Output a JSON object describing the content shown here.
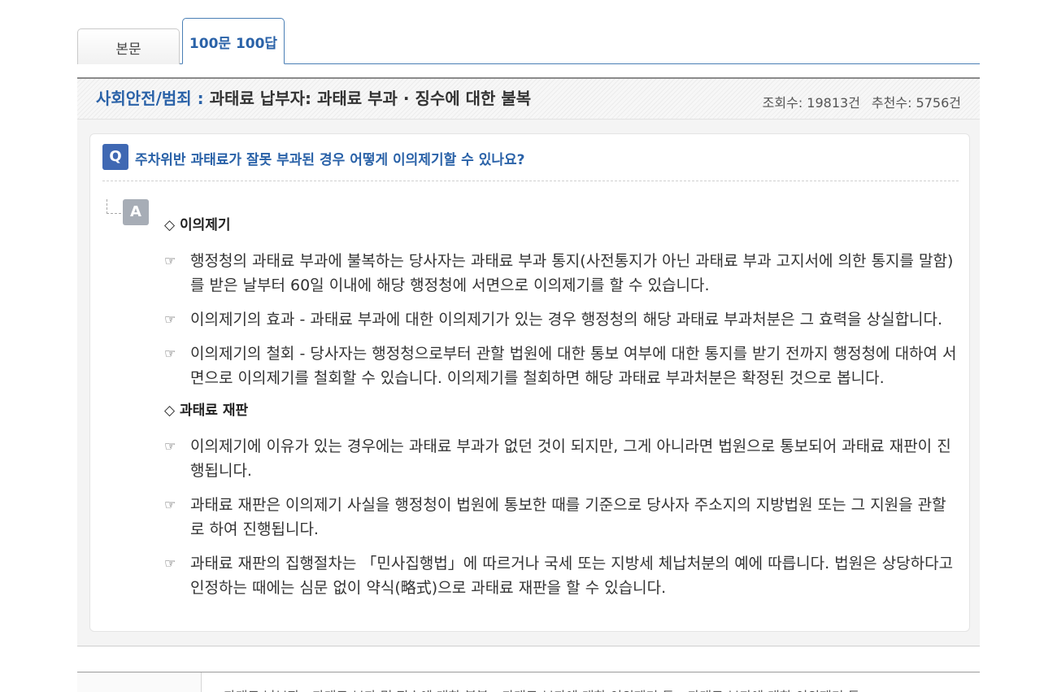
{
  "tabs": [
    {
      "label": "본문",
      "active": false
    },
    {
      "label": "100문 100답",
      "active": true
    }
  ],
  "title_bar": {
    "category": "사회안전/범죄",
    "separator": " : ",
    "title": "과태료 납부자: 과태료 부과 · 징수에 대한 불복",
    "views": "조회수: 19813건",
    "recommends": "추천수: 5756건"
  },
  "question": {
    "badge": "Q",
    "text": "주차위반 과태료가 잘못 부과된 경우 어떻게 이의제기할 수 있나요?"
  },
  "answer": {
    "badge": "A",
    "sections": [
      {
        "heading": "◇ 이의제기",
        "items": [
          "행정청의 과태료 부과에 불복하는 당사자는 과태료 부과 통지(사전통지가 아닌 과태료 부과 고지서에 의한 통지를 말함)를 받은 날부터 60일 이내에 해당 행정청에 서면으로 이의제기를 할 수 있습니다.",
          "이의제기의 효과 - 과태료 부과에 대한 이의제기가 있는 경우 행정청의 해당 과태료 부과처분은 그 효력을 상실합니다.",
          "이의제기의 철회 - 당사자는 행정청으로부터 관할 법원에 대한 통보 여부에 대한 통지를 받기 전까지 행정청에 대하여 서면으로 이의제기를 철회할 수 있습니다. 이의제기를 철회하면 해당 과태료 부과처분은 확정된 것으로 봅니다."
        ]
      },
      {
        "heading": "◇ 과태료 재판",
        "items": [
          "이의제기에 이유가 있는 경우에는 과태료 부과가 없던 것이 되지만, 그게 아니라면 법원으로 통보되어 과태료 재판이 진행됩니다.",
          "과태료 재판은 이의제기 사실을 행정청이 법원에 통보한 때를 기준으로 당사자 주소지의 지방법원 또는 그 지원을 관할로 하여 진행됩니다.",
          "과태료 재판의 집행절차는 「민사집행법」에 따르거나 국세 또는 지방세 체납처분의 예에 따릅니다. 법원은 상당하다고 인정하는 때에는 심문 없이 약식(略式)으로 과태료 재판을 할 수 있습니다."
        ]
      }
    ],
    "bullet_symbol": "☞"
  },
  "related": {
    "text": "과태료 납부자 : 과태료 부과 및 징수에 대한 불복 › 과태료 부과에 대한 이의제기 등 › 과태료 부과에 대한 이의제기 등"
  },
  "colors": {
    "accent": "#2a62a8",
    "q_badge": "#3f68b3",
    "a_badge": "#a7adb6"
  }
}
